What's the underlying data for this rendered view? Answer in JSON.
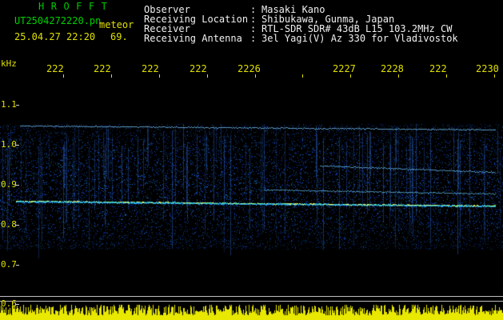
{
  "header": {
    "brand": "HROFFT",
    "filename": "UT2504272220.pn",
    "tag": "meteor",
    "datetime": "25.04.27 22:20",
    "count": "69.",
    "info": [
      {
        "label": "Observer",
        "sep": ":",
        "value": "Masaki Kano"
      },
      {
        "label": "Receiving Location",
        "sep": ":",
        "value": "Shibukawa, Gunma, Japan"
      },
      {
        "label": "Receiver",
        "sep": ":",
        "value": "RTL-SDR SDR# 43dB L15 103.2MHz CW"
      },
      {
        "label": "Receiving Antenna",
        "sep": ":",
        "value": "3el Yagi(V) Az 330 for Vladivostok"
      }
    ]
  },
  "axis": {
    "unit": "kHz",
    "y_ticks": [
      "1.1",
      "1.0",
      "0.9",
      "0.8",
      "0.7",
      "0.6"
    ],
    "x_ticks": [
      "222",
      "222",
      "222",
      "222",
      "2226",
      "2227",
      "2228",
      "222",
      "2230"
    ]
  },
  "colors": {
    "label": "#e0e000",
    "brand": "#00c800",
    "signal_strong": "#ffff40",
    "signal_mid": "#2aa0ff",
    "noise": "#1020a0"
  }
}
